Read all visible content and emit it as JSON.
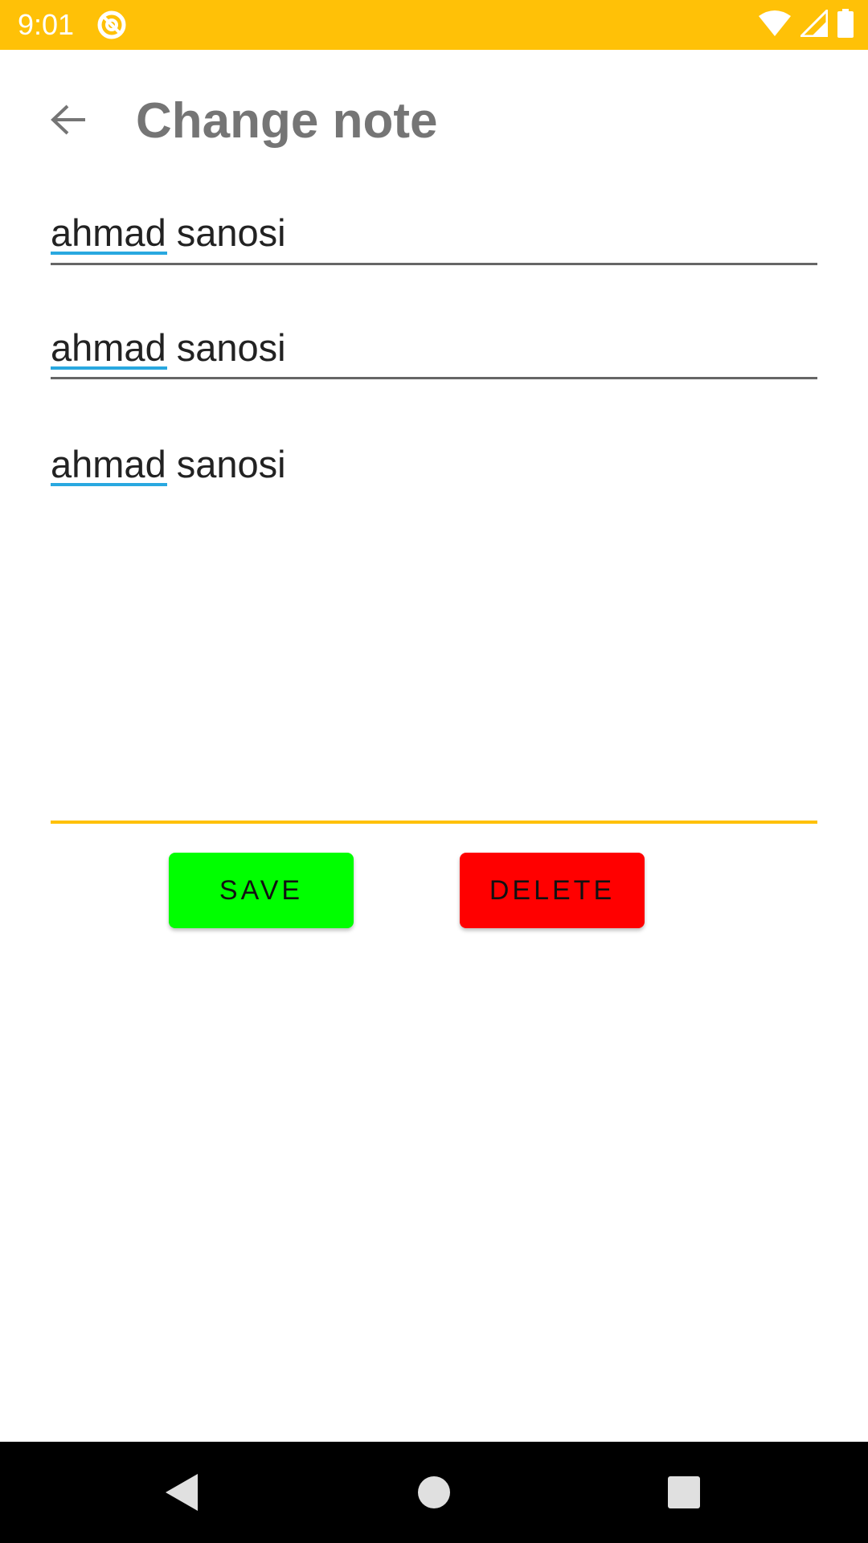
{
  "status_bar": {
    "time": "9:01",
    "color": "#FFC107",
    "icons": [
      "app-notification-icon",
      "wifi-icon",
      "cell-signal-icon",
      "battery-icon"
    ]
  },
  "app_bar": {
    "title": "Change note",
    "back_icon": "arrow-back-icon"
  },
  "form": {
    "field1_value": "ahmad sanosi",
    "field2_value": "ahmad sanosi",
    "field3_value": "ahmad sanosi",
    "misspelled_word": "ahmad",
    "focused_field_accent": "#FFC107",
    "spellcheck_color": "#29A8E0"
  },
  "buttons": {
    "save_label": "SAVE",
    "save_color": "#00FF00",
    "delete_label": "DELETE",
    "delete_color": "#FF0000"
  },
  "nav_bar": {
    "icons": [
      "nav-back-icon",
      "nav-home-icon",
      "nav-recents-icon"
    ]
  }
}
